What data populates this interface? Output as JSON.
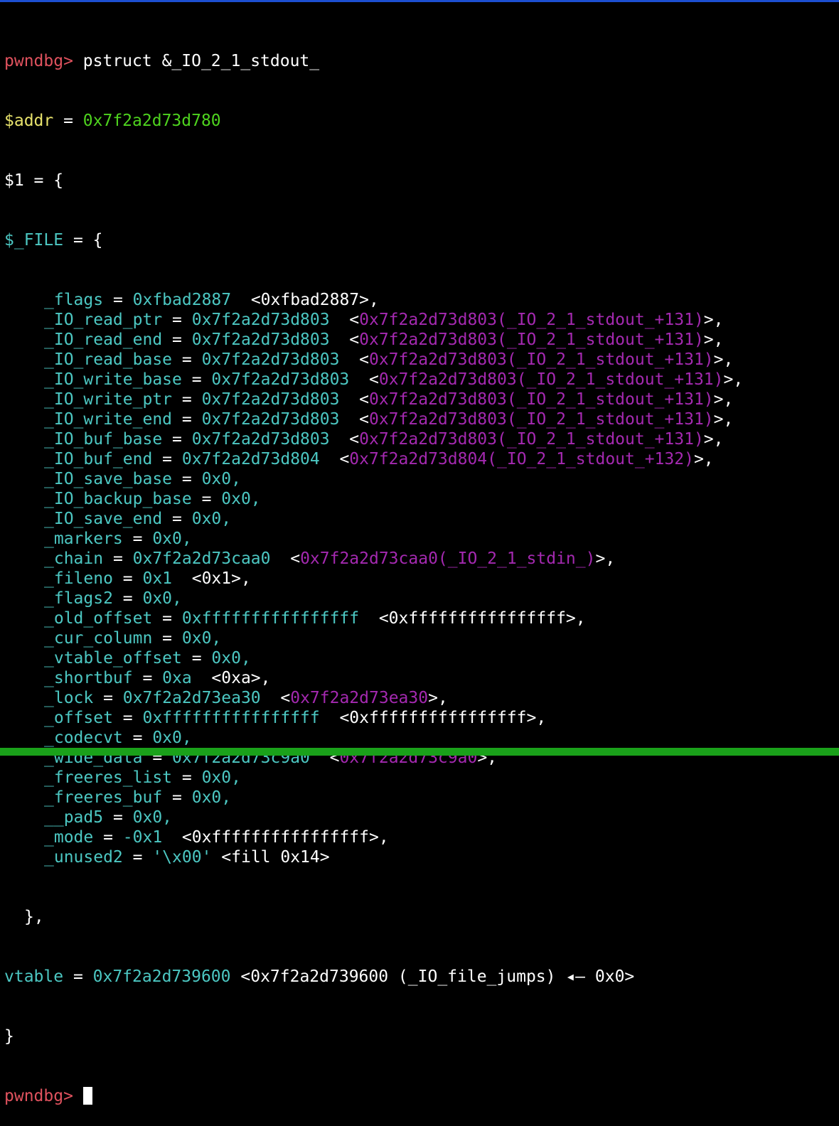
{
  "colors": {
    "prompt": "#e0525e",
    "variable": "#e8e36c",
    "address": "#4ed31e",
    "field": "#4cc7c2",
    "pointer_target": "#a429b0",
    "top_bar": "#1c4fd0",
    "status_bar": "#1aa11a"
  },
  "terminal": {
    "prompt": "pwndbg>",
    "command": "pstruct &_IO_2_1_stdout_",
    "addr_var": "$addr",
    "addr_value": "0x7f2a2d73d780",
    "result_header": "$1 = {",
    "struct_name": "$_FILE",
    "struct_open": " = {",
    "fields": [
      {
        "name": "_flags",
        "value": "0xfbad2887",
        "deref": "<0xfbad2887>,",
        "deref_type": "plain"
      },
      {
        "name": "_IO_read_ptr",
        "value": "0x7f2a2d73d803",
        "deref": "0x7f2a2d73d803(_IO_2_1_stdout_+131)",
        "deref_type": "ptr"
      },
      {
        "name": "_IO_read_end",
        "value": "0x7f2a2d73d803",
        "deref": "0x7f2a2d73d803(_IO_2_1_stdout_+131)",
        "deref_type": "ptr"
      },
      {
        "name": "_IO_read_base",
        "value": "0x7f2a2d73d803",
        "deref": "0x7f2a2d73d803(_IO_2_1_stdout_+131)",
        "deref_type": "ptr"
      },
      {
        "name": "_IO_write_base",
        "value": "0x7f2a2d73d803",
        "deref": "0x7f2a2d73d803(_IO_2_1_stdout_+131)",
        "deref_type": "ptr"
      },
      {
        "name": "_IO_write_ptr",
        "value": "0x7f2a2d73d803",
        "deref": "0x7f2a2d73d803(_IO_2_1_stdout_+131)",
        "deref_type": "ptr"
      },
      {
        "name": "_IO_write_end",
        "value": "0x7f2a2d73d803",
        "deref": "0x7f2a2d73d803(_IO_2_1_stdout_+131)",
        "deref_type": "ptr"
      },
      {
        "name": "_IO_buf_base",
        "value": "0x7f2a2d73d803",
        "deref": "0x7f2a2d73d803(_IO_2_1_stdout_+131)",
        "deref_type": "ptr"
      },
      {
        "name": "_IO_buf_end",
        "value": "0x7f2a2d73d804",
        "deref": "0x7f2a2d73d804(_IO_2_1_stdout_+132)",
        "deref_type": "ptr"
      },
      {
        "name": "_IO_save_base",
        "value": "0x0,",
        "deref": "",
        "deref_type": "none"
      },
      {
        "name": "_IO_backup_base",
        "value": "0x0,",
        "deref": "",
        "deref_type": "none"
      },
      {
        "name": "_IO_save_end",
        "value": "0x0,",
        "deref": "",
        "deref_type": "none"
      },
      {
        "name": "_markers",
        "value": "0x0,",
        "deref": "",
        "deref_type": "none"
      },
      {
        "name": "_chain",
        "value": "0x7f2a2d73caa0",
        "deref": "0x7f2a2d73caa0(_IO_2_1_stdin_)",
        "deref_type": "ptr"
      },
      {
        "name": "_fileno",
        "value": "0x1",
        "deref": "<0x1>,",
        "deref_type": "plain"
      },
      {
        "name": "_flags2",
        "value": "0x0,",
        "deref": "",
        "deref_type": "none"
      },
      {
        "name": "_old_offset",
        "value": "0xffffffffffffffff",
        "deref": "<0xffffffffffffffff>,",
        "deref_type": "plain"
      },
      {
        "name": "_cur_column",
        "value": "0x0,",
        "deref": "",
        "deref_type": "none"
      },
      {
        "name": "_vtable_offset",
        "value": "0x0,",
        "deref": "",
        "deref_type": "none"
      },
      {
        "name": "_shortbuf",
        "value": "0xa",
        "deref": "<0xa>,",
        "deref_type": "plain"
      },
      {
        "name": "_lock",
        "value": "0x7f2a2d73ea30",
        "deref": "0x7f2a2d73ea30",
        "deref_type": "ptr"
      },
      {
        "name": "_offset",
        "value": "0xffffffffffffffff",
        "deref": "<0xffffffffffffffff>,",
        "deref_type": "plain"
      },
      {
        "name": "_codecvt",
        "value": "0x0,",
        "deref": "",
        "deref_type": "none"
      },
      {
        "name": "_wide_data",
        "value": "0x7f2a2d73c9a0",
        "deref": "0x7f2a2d73c9a0",
        "deref_type": "ptr"
      },
      {
        "name": "_freeres_list",
        "value": "0x0,",
        "deref": "",
        "deref_type": "none"
      },
      {
        "name": "_freeres_buf",
        "value": "0x0,",
        "deref": "",
        "deref_type": "none"
      },
      {
        "name": "__pad5",
        "value": "0x0,",
        "deref": "",
        "deref_type": "none"
      },
      {
        "name": "_mode",
        "value": "-0x1",
        "deref": "<0xffffffffffffffff>,",
        "deref_type": "plain"
      },
      {
        "name": "_unused2",
        "value": "'\\x00'",
        "deref": "<fill 0x14>",
        "deref_type": "raw"
      }
    ],
    "inner_close": "},",
    "vtable_label": "vtable",
    "vtable_value": "0x7f2a2d739600",
    "vtable_deref": "<0x7f2a2d739600 (_IO_file_jumps) ◂— 0x0>",
    "outer_close": "}",
    "final_prompt": "pwndbg>"
  }
}
